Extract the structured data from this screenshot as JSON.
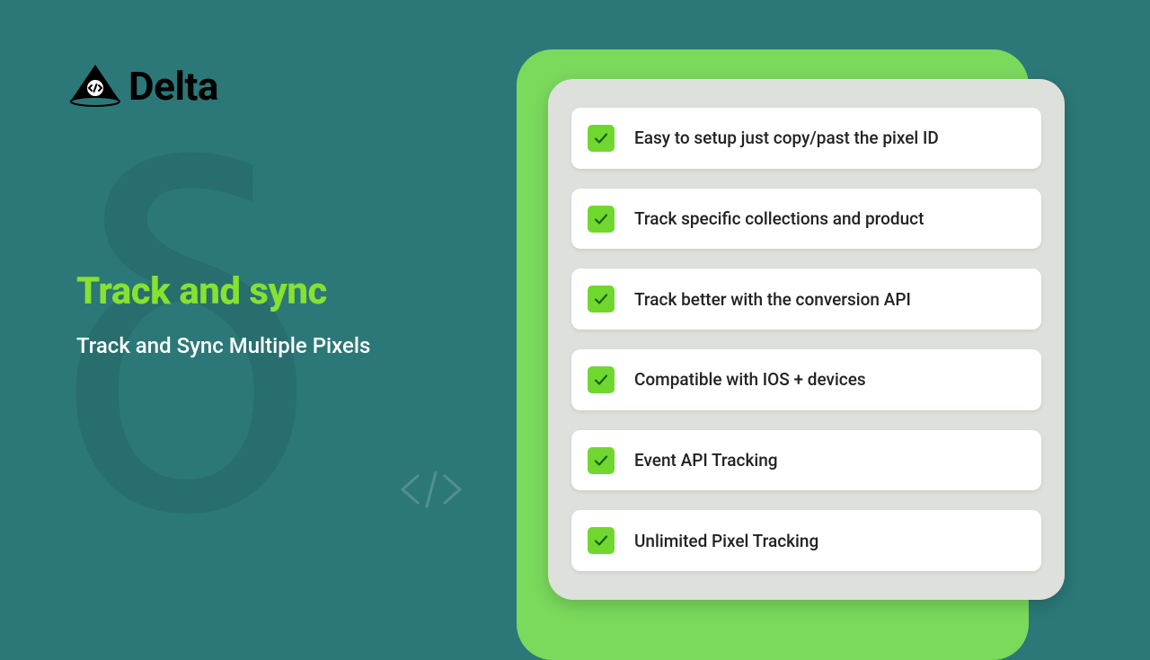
{
  "brand": {
    "name": "Delta"
  },
  "hero": {
    "title": "Track and sync",
    "subtitle": "Track and Sync Multiple Pixels"
  },
  "features": [
    "Easy to setup just copy/past  the pixel ID",
    "Track specific collections and product",
    "Track better with the conversion API",
    "Compatible with IOS + devices",
    "Event API Tracking",
    "Unlimited Pixel Tracking"
  ],
  "colors": {
    "background": "#2c7878",
    "accent": "#86e22e",
    "check": "#70d72e",
    "cardBack": "#7bd95c",
    "cardFront": "#dde0db"
  }
}
